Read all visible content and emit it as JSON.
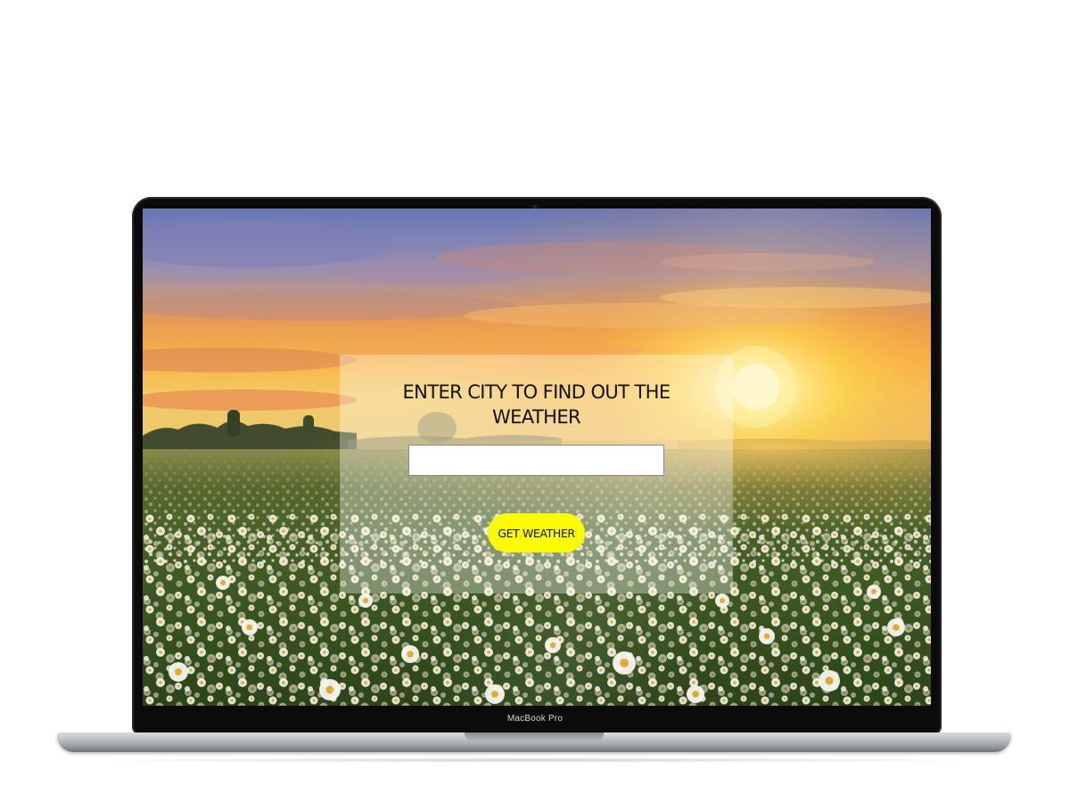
{
  "device": {
    "model_label": "MacBook Pro"
  },
  "app": {
    "title": "ENTER CITY TO FIND OUT THE WEATHER",
    "city_input": {
      "value": "",
      "placeholder": ""
    },
    "submit_button_label": "GET WEATHER"
  },
  "background": {
    "scene": "sunrise over daisy meadow",
    "sky_colors": [
      "#6f7fb8",
      "#f2a54a",
      "#ffd84a"
    ],
    "field_colors": [
      "#3d5a1e",
      "#f4f4ec"
    ]
  },
  "colors": {
    "button": "#fbfb00",
    "card_overlay": "rgba(255,255,255,0.34)",
    "title_text": "#111111"
  },
  "icons": {
    "camera": "camera-dot-icon"
  }
}
